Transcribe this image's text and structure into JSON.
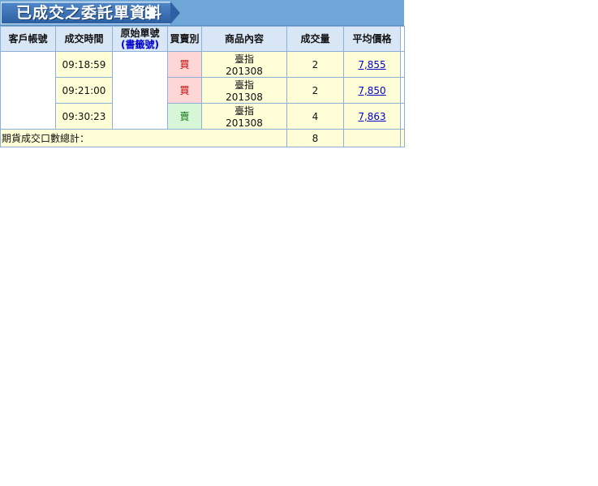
{
  "page": {
    "title": "已成交之委託單資料",
    "title_suffix": "："
  },
  "table": {
    "headers": [
      "客戶帳號",
      "成交時間",
      "原始單號",
      "(書籤號)",
      "買賣別",
      "商品內容",
      "成交量",
      "平均價格"
    ],
    "rows": [
      {
        "time": "09:18:59",
        "side": "買",
        "product_name": "臺指",
        "product_month": "201308",
        "qty": "2",
        "avg_price": "7,855"
      },
      {
        "time": "09:21:00",
        "side": "買",
        "product_name": "臺指",
        "product_month": "201308",
        "qty": "2",
        "avg_price": "7,850"
      },
      {
        "time": "09:30:23",
        "side": "賣",
        "product_name": "臺指",
        "product_month": "201308",
        "qty": "4",
        "avg_price": "7,863"
      }
    ],
    "footer_label": "期貨成交口數總計：",
    "footer_total": "8"
  },
  "colors": {
    "header_bg": "#d8e6f6",
    "row_bg": "#fffed6",
    "buy_bg": "#ffd6d6",
    "sell_bg": "#d7f5d7",
    "title_bg": "#6fa6d8"
  }
}
